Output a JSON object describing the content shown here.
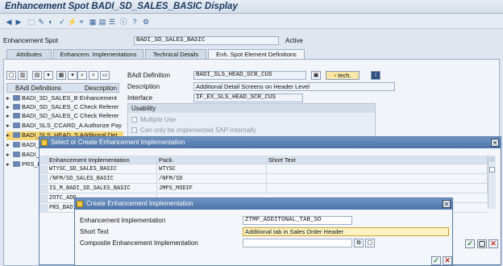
{
  "window": {
    "title": "Enhancement Spot BADI_SD_SALES_BASIC Display"
  },
  "header": {
    "spot_label": "Enhancement Spot",
    "spot_value": "BADI_SD_SALES_BASIC",
    "status": "Active"
  },
  "tabs": [
    {
      "label": "Attributes"
    },
    {
      "label": "Enhancem. Implementations"
    },
    {
      "label": "Technical Details"
    },
    {
      "label": "Enh. Spot Element Definitions"
    }
  ],
  "tree": {
    "col1": "BAdI Definitions",
    "col2": "Description",
    "rows": [
      {
        "name": "BADI_SD_SALES_B",
        "desc": "Enhancement"
      },
      {
        "name": "BADI_SD_SALES_C",
        "desc": "Check Referer"
      },
      {
        "name": "BADI_SD_SALES_C",
        "desc": "Check Referer"
      },
      {
        "name": "BADI_SLS_CCARD_A",
        "desc": "Authorize Pay"
      },
      {
        "name": "BADI_SLS_HEAD_S",
        "desc": "Additional Det"
      },
      {
        "name": "BADI_",
        "desc": ""
      },
      {
        "name": "BADI_",
        "desc": ""
      },
      {
        "name": "PRS_BAD",
        "desc": ""
      }
    ]
  },
  "detail": {
    "badi_label": "BAdI Definition",
    "badi_value": "BADI_SLS_HEAD_SCR_CUS",
    "tech_label": "tech.",
    "desc_label": "Description",
    "desc_value": "Additional Detail Screens on Header Level",
    "iface_label": "Interface",
    "iface_value": "IF_EX_SLS_HEAD_SCR_CUS",
    "usability_label": "Usability",
    "multiple_use": "Multiple Use",
    "sap_internal": "Can only be implemented SAP-internally"
  },
  "dialog1": {
    "title": "Select or Create Enhancement Implementation",
    "col_impl": "Enhancement Implementation",
    "col_pack": "Pack.",
    "col_short": "Short Text",
    "rows": [
      {
        "impl": "WTYSC_SD_SALES_BASIC",
        "pack": "WTYSC"
      },
      {
        "impl": "/NFM/SD_SALES_BASIC",
        "pack": "/NFM/SD"
      },
      {
        "impl": "IS_M_BADI_SD_SALES_BASIC",
        "pack": "JMPS_MODIF"
      },
      {
        "impl": "ZOTC_ADD",
        "pack": ""
      },
      {
        "impl": "PRS_BADI",
        "pack": ""
      }
    ]
  },
  "dialog2": {
    "title": "Create Enhancement Implementation",
    "impl_label": "Enhancement Implementation",
    "impl_value": "ZTMP_ADDITONAL_TAB_SO",
    "short_label": "Short Text",
    "short_value": "Additional tab in Sales Order Header",
    "comp_label": "Composite Enhancement Implementation",
    "comp_value": ""
  },
  "colors": {
    "dialog_header": "#5a7fb0",
    "accent": "#2e5f9a",
    "ok": "#2e8b2e",
    "cancel": "#c0392b"
  }
}
